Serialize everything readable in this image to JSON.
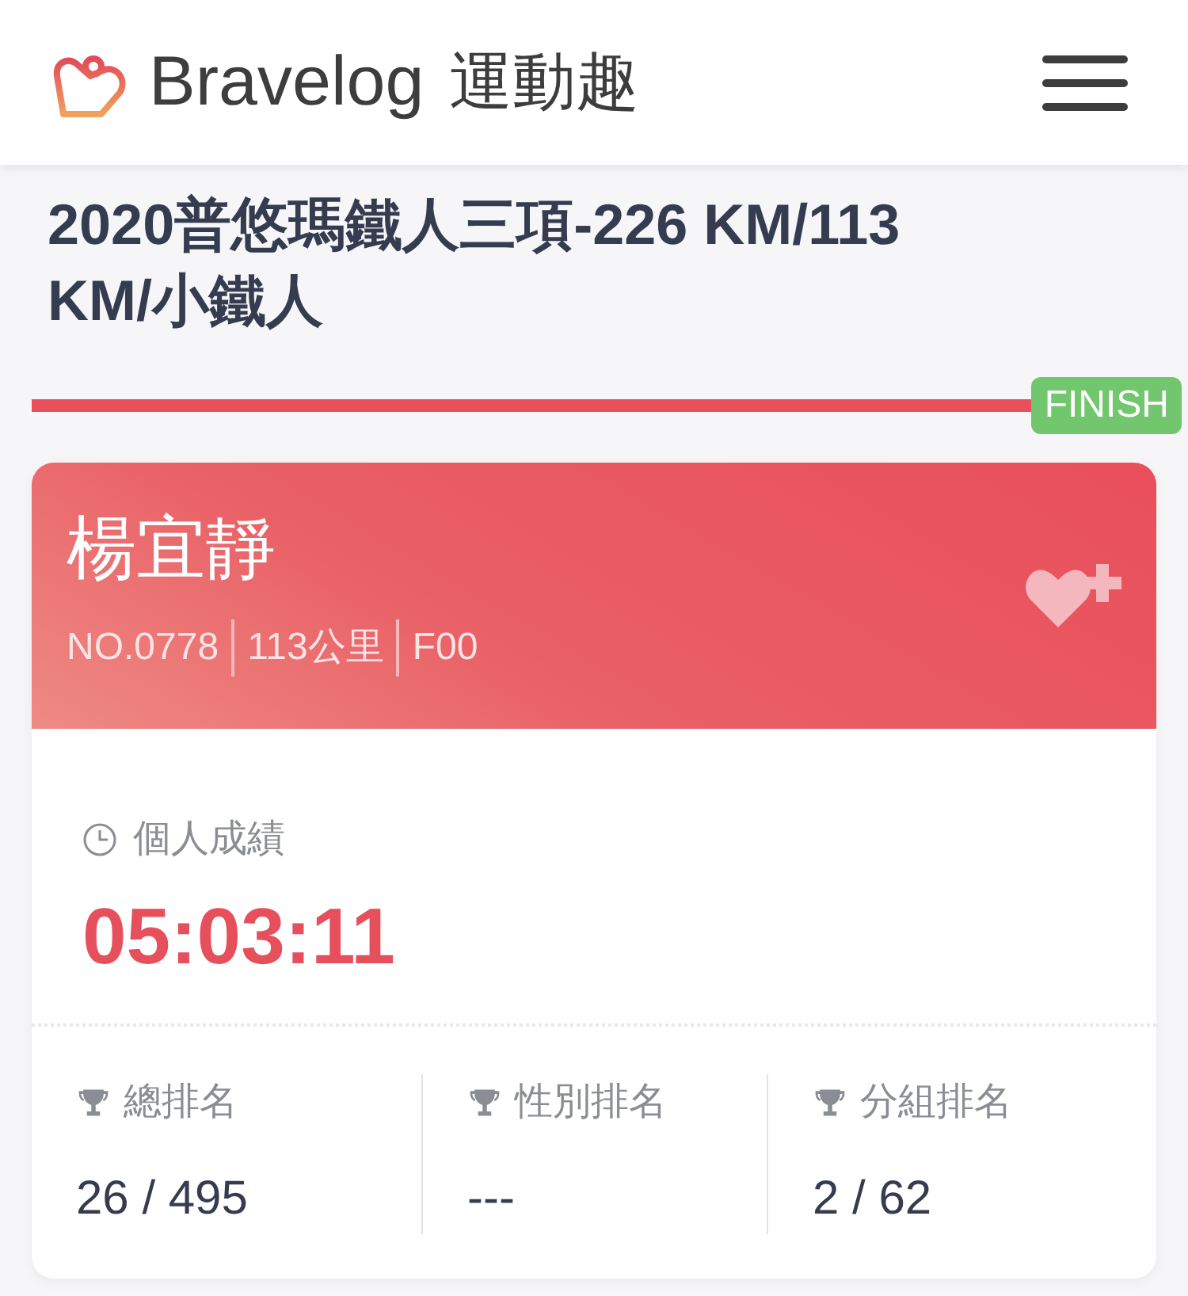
{
  "header": {
    "brand": "Bravelog",
    "brand_sub": "運動趣"
  },
  "event": {
    "title": "2020普悠瑪鐵人三項-226 KM/113 KM/小鐵人"
  },
  "progress": {
    "level": 1,
    "status": "FINISH"
  },
  "athlete": {
    "name": "楊宜靜",
    "meta": [
      "NO.0778",
      "113公里",
      "F00"
    ]
  },
  "result": {
    "label": "個人成績",
    "time": "05:03:11"
  },
  "rankings": [
    {
      "label": "總排名",
      "value": "26 / 495"
    },
    {
      "label": "性別排名",
      "value": "---"
    },
    {
      "label": "分組排名",
      "value": "2 / 62"
    }
  ]
}
